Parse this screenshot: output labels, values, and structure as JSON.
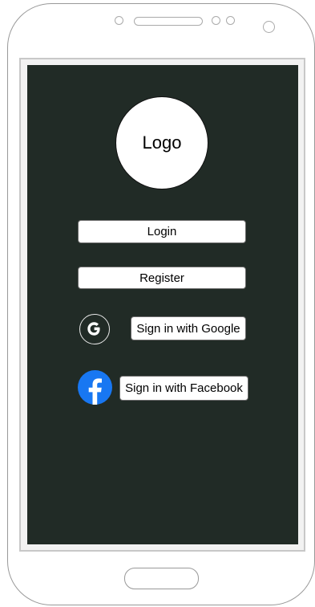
{
  "screen": {
    "logo_text": "Logo",
    "login_label": "Login",
    "register_label": "Register",
    "google_label": "Sign in with Google",
    "facebook_label": "Sign in with Facebook"
  },
  "icons": {
    "google": "google-icon",
    "facebook": "facebook-icon"
  },
  "colors": {
    "screen_background": "#212b26",
    "button_background": "#ffffff",
    "facebook_blue": "#1877f2"
  }
}
